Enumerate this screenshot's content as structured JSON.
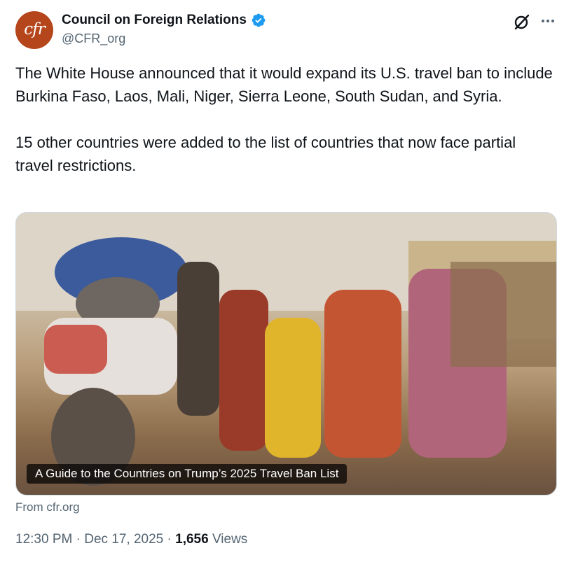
{
  "author": {
    "avatar_text": "cfr",
    "display_name": "Council on Foreign Relations",
    "handle": "@CFR_org",
    "verified": true,
    "brand_color": "#b5451b",
    "verified_color": "#1d9bf0"
  },
  "tweet": {
    "text": "The White House announced that it would expand its U.S. travel ban to include Burkina Faso, Laos, Mali, Niger, Sierra Leone, South Sudan, and Syria.\n\n15 other countries were added to the list of countries that now face partial travel restrictions."
  },
  "link_card": {
    "title": "A Guide to the Countries on Trump’s 2025 Travel Ban List",
    "source": "From cfr.org"
  },
  "meta": {
    "time": "12:30 PM",
    "date": "Dec 17, 2025",
    "views_count": "1,656",
    "views_label": "Views",
    "separator": "·"
  },
  "icons": {
    "grok": "grok-icon",
    "more": "more-icon",
    "verified": "verified-badge-icon"
  }
}
